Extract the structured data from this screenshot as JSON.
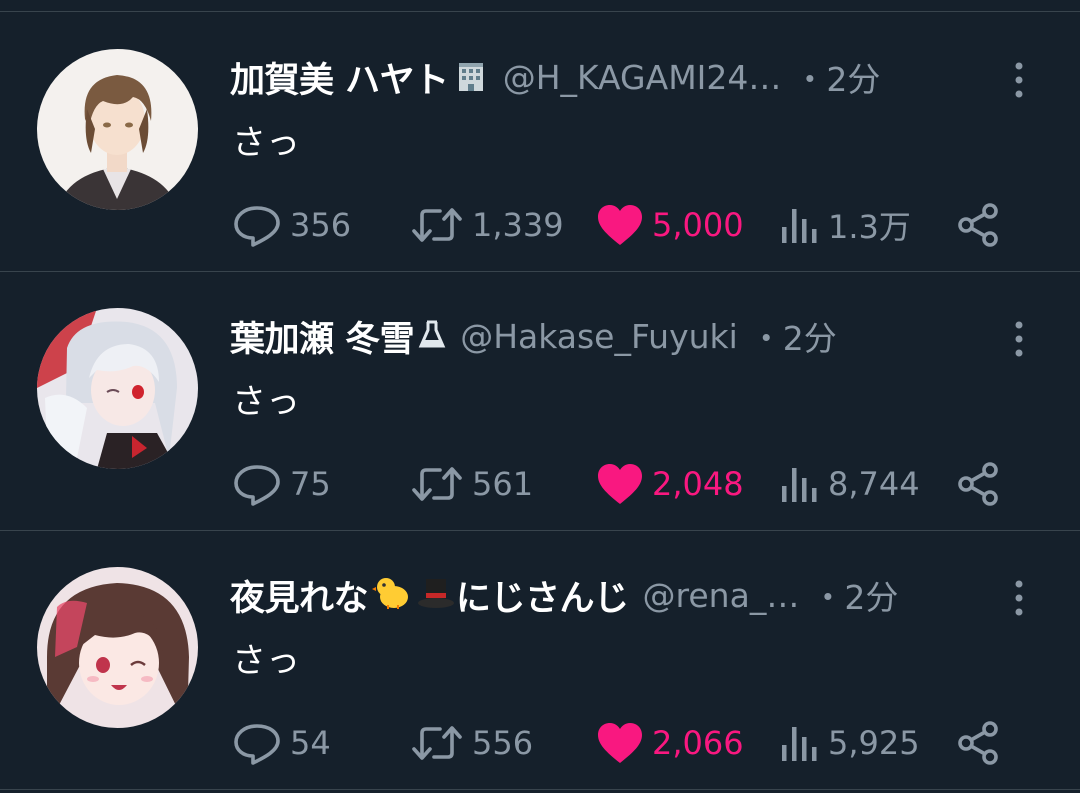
{
  "tweets": [
    {
      "display_name": "加賀美 ハヤト",
      "name_emoji": [
        "office-building-icon"
      ],
      "handle": "@H_KAGAMI24…",
      "time": "・2分",
      "text": "さっ",
      "replies": "356",
      "retweets": "1,339",
      "likes": "5,000",
      "views": "1.3万",
      "liked": true
    },
    {
      "display_name": "葉加瀬 冬雪",
      "name_emoji": [
        "flask-icon"
      ],
      "handle": "@Hakase_Fuyuki",
      "time": "・2分",
      "text": "さっ",
      "replies": "75",
      "retweets": "561",
      "likes": "2,048",
      "views": "8,744",
      "liked": true
    },
    {
      "display_name": "夜見れな",
      "name_emoji": [
        "chick-icon",
        "top-hat-icon"
      ],
      "name_suffix": "にじさんじ",
      "handle": "@rena_…",
      "time": "・2分",
      "text": "さっ",
      "replies": "54",
      "retweets": "556",
      "likes": "2,066",
      "views": "5,925",
      "liked": true
    }
  ],
  "colors": {
    "background": "#15202b",
    "divider": "#38444d",
    "secondary_text": "#8b98a5",
    "like_pink": "#f91880"
  }
}
